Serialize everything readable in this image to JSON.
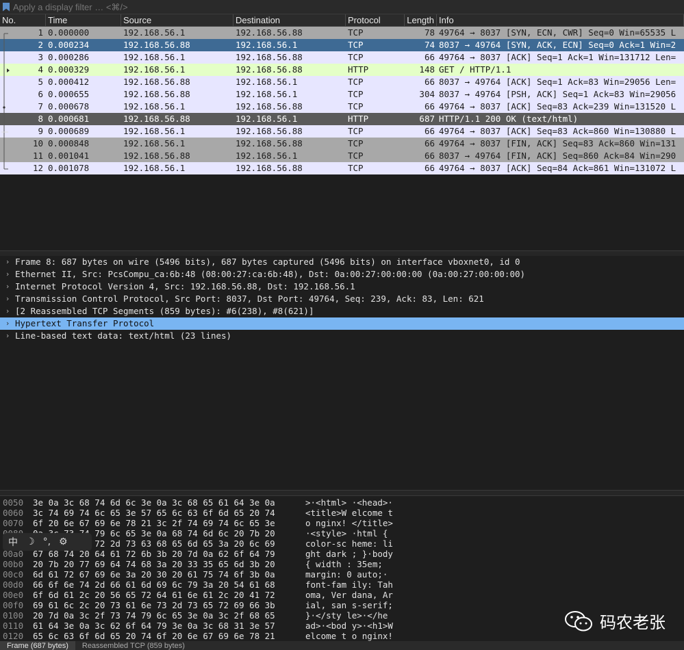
{
  "filter": {
    "placeholder": "Apply a display filter … <⌘/>"
  },
  "columns": {
    "no": "No.",
    "time": "Time",
    "source": "Source",
    "destination": "Destination",
    "protocol": "Protocol",
    "length": "Length",
    "info": "Info"
  },
  "packets": [
    {
      "no": "1",
      "time": "0.000000",
      "src": "192.168.56.1",
      "dst": "192.168.56.88",
      "proto": "TCP",
      "len": "78",
      "info": "49764 → 8037 [SYN, ECN, CWR] Seq=0 Win=65535 L"
    },
    {
      "no": "2",
      "time": "0.000234",
      "src": "192.168.56.88",
      "dst": "192.168.56.1",
      "proto": "TCP",
      "len": "74",
      "info": "8037 → 49764 [SYN, ACK, ECN] Seq=0 Ack=1 Win=2"
    },
    {
      "no": "3",
      "time": "0.000286",
      "src": "192.168.56.1",
      "dst": "192.168.56.88",
      "proto": "TCP",
      "len": "66",
      "info": "49764 → 8037 [ACK] Seq=1 Ack=1 Win=131712 Len="
    },
    {
      "no": "4",
      "time": "0.000329",
      "src": "192.168.56.1",
      "dst": "192.168.56.88",
      "proto": "HTTP",
      "len": "148",
      "info": "GET / HTTP/1.1"
    },
    {
      "no": "5",
      "time": "0.000412",
      "src": "192.168.56.88",
      "dst": "192.168.56.1",
      "proto": "TCP",
      "len": "66",
      "info": "8037 → 49764 [ACK] Seq=1 Ack=83 Win=29056 Len="
    },
    {
      "no": "6",
      "time": "0.000655",
      "src": "192.168.56.88",
      "dst": "192.168.56.1",
      "proto": "TCP",
      "len": "304",
      "info": "8037 → 49764 [PSH, ACK] Seq=1 Ack=83 Win=29056"
    },
    {
      "no": "7",
      "time": "0.000678",
      "src": "192.168.56.1",
      "dst": "192.168.56.88",
      "proto": "TCP",
      "len": "66",
      "info": "49764 → 8037 [ACK] Seq=83 Ack=239 Win=131520 L"
    },
    {
      "no": "8",
      "time": "0.000681",
      "src": "192.168.56.88",
      "dst": "192.168.56.1",
      "proto": "HTTP",
      "len": "687",
      "info": "HTTP/1.1 200 OK  (text/html)"
    },
    {
      "no": "9",
      "time": "0.000689",
      "src": "192.168.56.1",
      "dst": "192.168.56.88",
      "proto": "TCP",
      "len": "66",
      "info": "49764 → 8037 [ACK] Seq=83 Ack=860 Win=130880 L"
    },
    {
      "no": "10",
      "time": "0.000848",
      "src": "192.168.56.1",
      "dst": "192.168.56.88",
      "proto": "TCP",
      "len": "66",
      "info": "49764 → 8037 [FIN, ACK] Seq=83 Ack=860 Win=131"
    },
    {
      "no": "11",
      "time": "0.001041",
      "src": "192.168.56.88",
      "dst": "192.168.56.1",
      "proto": "TCP",
      "len": "66",
      "info": "8037 → 49764 [FIN, ACK] Seq=860 Ack=84 Win=290"
    },
    {
      "no": "12",
      "time": "0.001078",
      "src": "192.168.56.1",
      "dst": "192.168.56.88",
      "proto": "TCP",
      "len": "66",
      "info": "49764 → 8037 [ACK] Seq=84 Ack=861 Win=131072 L"
    }
  ],
  "details": [
    "Frame 8: 687 bytes on wire (5496 bits), 687 bytes captured (5496 bits) on interface vboxnet0, id 0",
    "Ethernet II, Src: PcsCompu_ca:6b:48 (08:00:27:ca:6b:48), Dst: 0a:00:27:00:00:00 (0a:00:27:00:00:00)",
    "Internet Protocol Version 4, Src: 192.168.56.88, Dst: 192.168.56.1",
    "Transmission Control Protocol, Src Port: 8037, Dst Port: 49764, Seq: 239, Ack: 83, Len: 621",
    "[2 Reassembled TCP Segments (859 bytes): #6(238), #8(621)]",
    "Hypertext Transfer Protocol",
    "Line-based text data: text/html (23 lines)"
  ],
  "bytes": [
    {
      "off": "0050",
      "hex": "3e 0a 3c 68 74 6d 6c 3e  0a 3c 68 65 61 64 3e 0a",
      "asc": ">·<html> ·<head>·"
    },
    {
      "off": "0060",
      "hex": "3c 74 69 74 6c 65 3e 57  65 6c 63 6f 6d 65 20 74",
      "asc": "<title>W elcome t"
    },
    {
      "off": "0070",
      "hex": "6f 20 6e 67 69 6e 78 21  3c 2f 74 69 74 6c 65 3e",
      "asc": "o nginx! </title>"
    },
    {
      "off": "0080",
      "hex": "0a 3c 73 74 79 6c 65 3e  0a 68 74 6d 6c 20 7b 20",
      "asc": "·<style> ·html { "
    },
    {
      "off": "0090",
      "hex": "63 6f 6c 6f 72 2d 73 63  68 65 6d 65 3a 20 6c 69",
      "asc": "color-sc heme: li"
    },
    {
      "off": "00a0",
      "hex": "67 68 74 20 64 61 72 6b  3b 20 7d 0a 62 6f 64 79",
      "asc": "ght dark ; }·body"
    },
    {
      "off": "00b0",
      "hex": "20 7b 20 77 69 64 74 68  3a 20 33 35 65 6d 3b 20",
      "asc": " { width : 35em; "
    },
    {
      "off": "00c0",
      "hex": "6d 61 72 67 69 6e 3a 20  30 20 61 75 74 6f 3b 0a",
      "asc": "margin:  0 auto;·"
    },
    {
      "off": "00d0",
      "hex": "66 6f 6e 74 2d 66 61 6d  69 6c 79 3a 20 54 61 68",
      "asc": "font-fam ily: Tah"
    },
    {
      "off": "00e0",
      "hex": "6f 6d 61 2c 20 56 65 72  64 61 6e 61 2c 20 41 72",
      "asc": "oma, Ver dana, Ar"
    },
    {
      "off": "00f0",
      "hex": "69 61 6c 2c 20 73 61 6e  73 2d 73 65 72 69 66 3b",
      "asc": "ial, san s-serif;"
    },
    {
      "off": "0100",
      "hex": "20 7d 0a 3c 2f 73 74 79  6c 65 3e 0a 3c 2f 68 65",
      "asc": " }·</sty le>·</he"
    },
    {
      "off": "0110",
      "hex": "61 64 3e 0a 3c 62 6f 64  79 3e 0a 3c 68 31 3e 57",
      "asc": "ad>·<bod y>·<h1>W"
    },
    {
      "off": "0120",
      "hex": "65 6c 63 6f 6d 65 20 74  6f 20 6e 67 69 6e 78 21",
      "asc": "elcome t o nginx!"
    }
  ],
  "ime": {
    "lang": "中",
    "moon": "☽",
    "punct": "°,",
    "gear": "⚙"
  },
  "watermark": {
    "text": "码农老张"
  },
  "tabs": [
    "Frame (687 bytes)",
    "Reassembled TCP (859 bytes)"
  ],
  "colors": {
    "selected_row": "#3e6a94",
    "selected_detail": "#79b5f2",
    "http_row": "#e4ffc7",
    "tcp_row": "#e7e6ff"
  }
}
